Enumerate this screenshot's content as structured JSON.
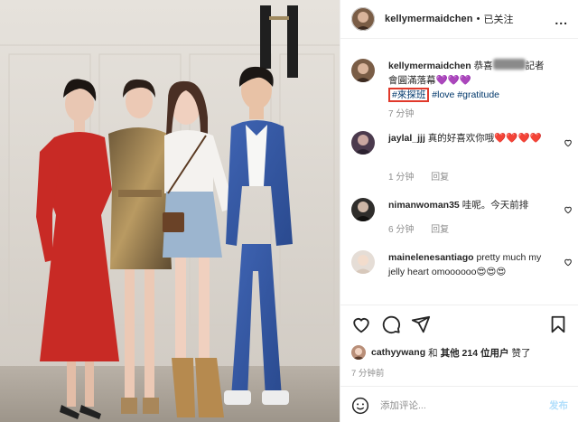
{
  "post": {
    "username": "kellymermaidchen",
    "separator": "•",
    "follow_status": "已关注",
    "more_label": "..."
  },
  "caption": {
    "username": "kellymermaidchen",
    "text_before_blur": "恭喜",
    "text_after_blur": "記者會圓滿落幕",
    "emoji": "💜💜💜",
    "hashtag_highlighted": "#來探班",
    "hashtag_love": "#love",
    "hashtag_gratitude": "#gratitude",
    "time": "7 分钟"
  },
  "comments": [
    {
      "username": "jaylal_jjj",
      "text": "真的好喜欢你哦",
      "hearts": "❤️❤️❤️❤️",
      "time": "1 分钟",
      "reply": "回复"
    },
    {
      "username": "nimanwoman35",
      "text": "哇呢。今天前排",
      "hearts": "",
      "time": "6 分钟",
      "reply": "回复"
    },
    {
      "username": "mainelenesantiago",
      "text": "pretty much my jelly heart omoooooo",
      "hearts": "😍😍😍",
      "time": "",
      "reply": ""
    }
  ],
  "likes": {
    "user": "cathyywang",
    "conj": "和",
    "others": "其他 214 位用户",
    "suffix": "赞了"
  },
  "post_time": "7 分钟前",
  "add_comment": {
    "placeholder": "添加评论...",
    "post_label": "发布"
  },
  "icons": {
    "like": "heart-icon",
    "comment": "comment-icon",
    "share": "share-icon",
    "save": "bookmark-icon",
    "emoji": "smiley-icon",
    "comment_like": "small-heart-icon",
    "more": "more-dots-icon"
  },
  "colors": {
    "highlight_box": "#e0392b",
    "hashtag": "#00376b",
    "meta_text": "#8e8e8e",
    "post_button_disabled": "#b2dffc"
  }
}
